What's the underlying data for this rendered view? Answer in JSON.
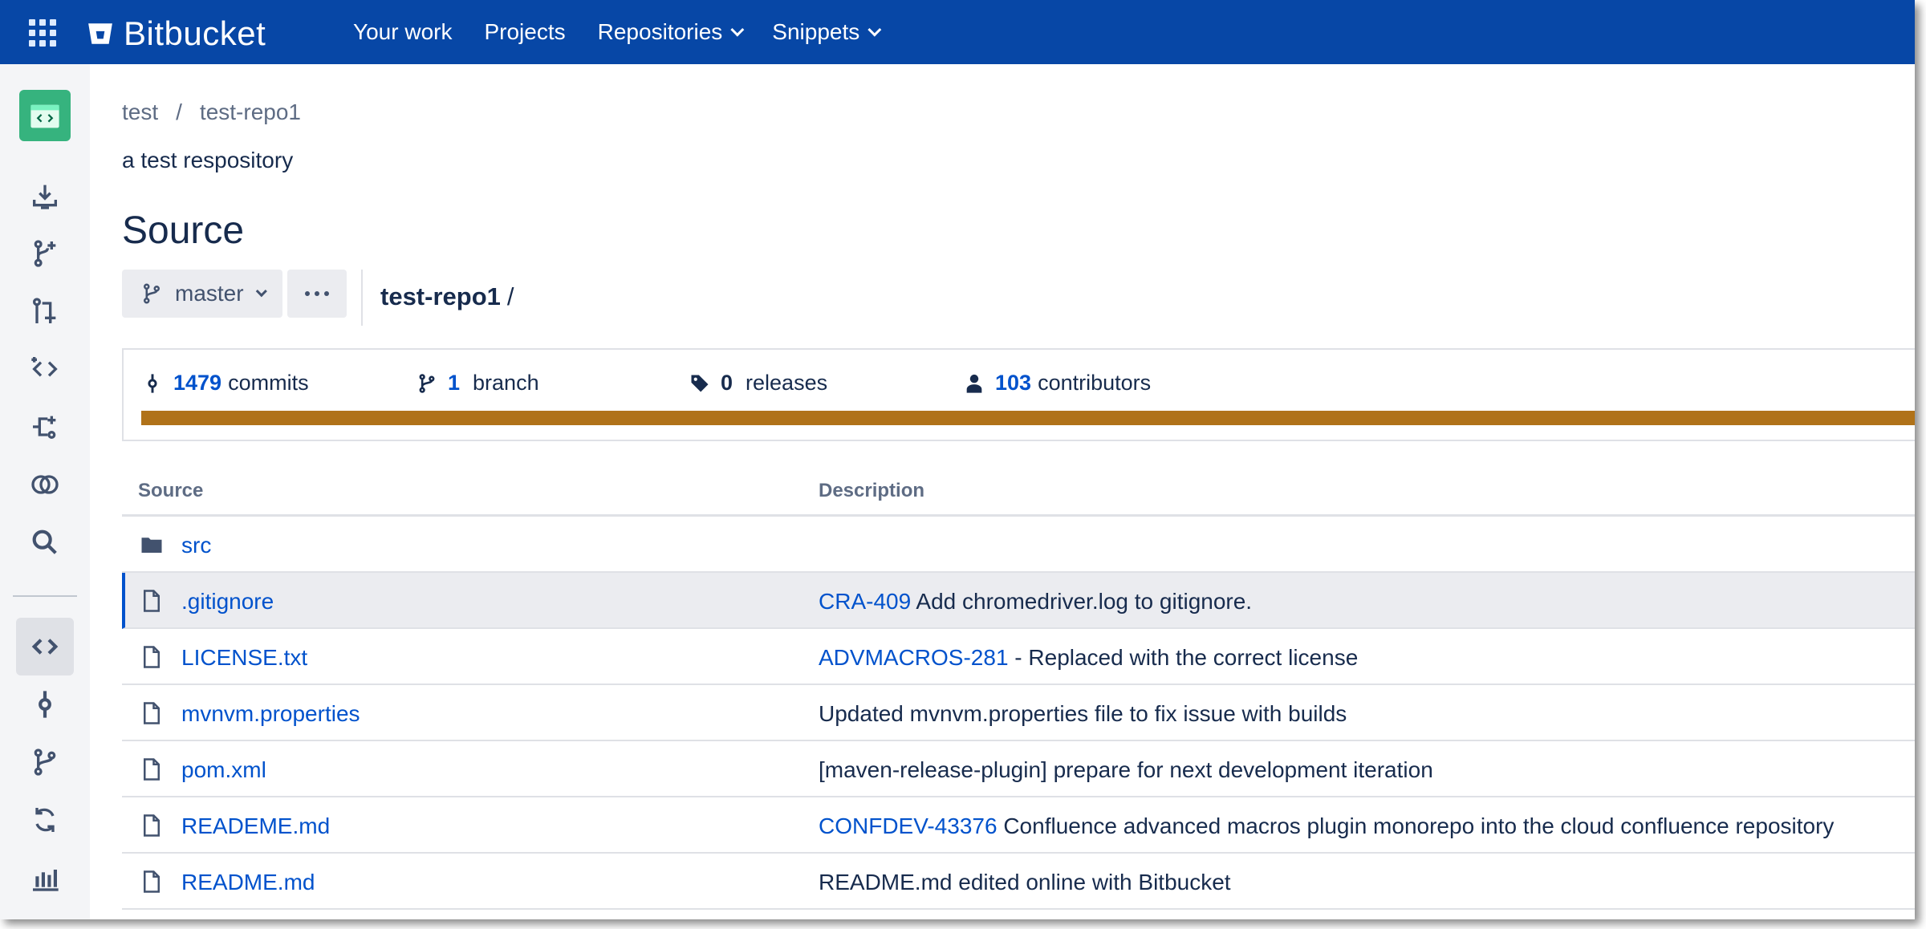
{
  "header": {
    "logo_text": "Bitbucket",
    "nav": [
      {
        "label": "Your work",
        "dropdown": false
      },
      {
        "label": "Projects",
        "dropdown": false
      },
      {
        "label": "Repositories",
        "dropdown": true
      },
      {
        "label": "Snippets",
        "dropdown": true
      }
    ],
    "bg_color": "#0747a6"
  },
  "sidebar": {
    "repo_avatar_color": "#36b37e",
    "items": [
      {
        "icon": "clone-icon"
      },
      {
        "icon": "create-branch-icon"
      },
      {
        "icon": "create-pull-request-icon"
      },
      {
        "icon": "compare-icon"
      },
      {
        "icon": "fork-icon"
      },
      {
        "icon": "compare-branches-icon"
      },
      {
        "icon": "search-icon"
      },
      {
        "icon": "source-icon",
        "active": true
      },
      {
        "icon": "commits-icon"
      },
      {
        "icon": "branches-icon"
      },
      {
        "icon": "pull-requests-icon"
      },
      {
        "icon": "reports-icon"
      }
    ]
  },
  "breadcrumb": {
    "project": "test",
    "separator": "/",
    "repo": "test-repo1"
  },
  "repo_description": "a test respository",
  "page_title": "Source",
  "branch_selector": {
    "label": "master"
  },
  "path": {
    "repo": "test-repo1",
    "slash": "/"
  },
  "stats": {
    "commits": {
      "count": "1479",
      "label": "commits"
    },
    "branches": {
      "count": "1",
      "label": "branch"
    },
    "releases": {
      "count": "0",
      "label": "releases"
    },
    "contributors": {
      "count": "103",
      "label": "contributors"
    },
    "language_color": "#b07219"
  },
  "table": {
    "headers": {
      "source": "Source",
      "description": "Description"
    },
    "rows": [
      {
        "type": "folder",
        "name": "src",
        "issue": "",
        "message": ""
      },
      {
        "type": "file",
        "name": ".gitignore",
        "issue": "CRA-409",
        "message": " Add chromedriver.log to gitignore.",
        "selected": true
      },
      {
        "type": "file",
        "name": "LICENSE.txt",
        "issue": "ADVMACROS-281",
        "message": " - Replaced with the correct license"
      },
      {
        "type": "file",
        "name": "mvnvm.properties",
        "issue": "",
        "message": "Updated mvnvm.properties file to fix issue with builds"
      },
      {
        "type": "file",
        "name": "pom.xml",
        "issue": "",
        "message": "[maven-release-plugin] prepare for next development iteration"
      },
      {
        "type": "file",
        "name": "READEME.md",
        "issue": "CONFDEV-43376",
        "message": " Confluence advanced macros plugin monorepo into the cloud confluence repository"
      },
      {
        "type": "file",
        "name": "README.md",
        "issue": "",
        "message": "README.md edited online with Bitbucket"
      }
    ]
  }
}
